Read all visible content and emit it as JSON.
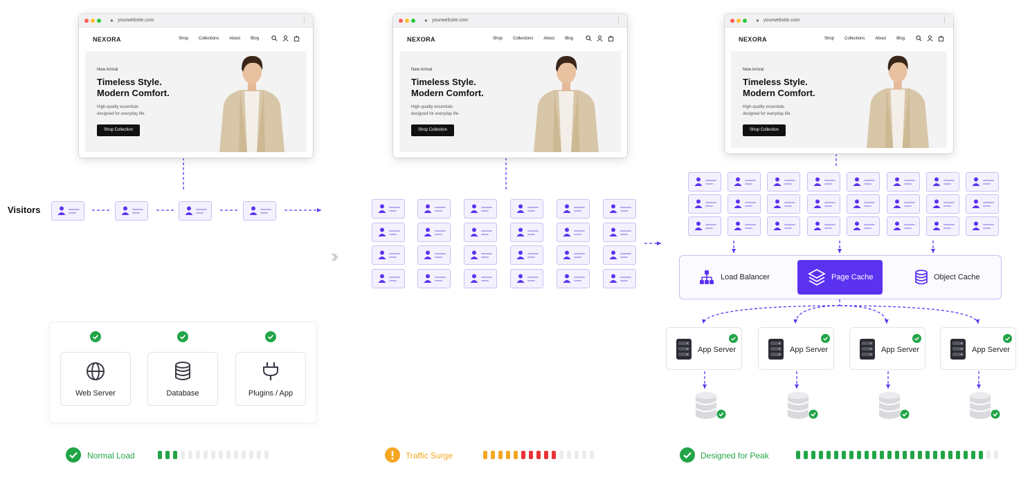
{
  "browser": {
    "url": "yourwebsite.com",
    "brand": "NEXORA",
    "nav": [
      "Shop",
      "Collections",
      "About",
      "Blog"
    ],
    "eyebrow": "New Arrival",
    "headline_1": "Timeless Style.",
    "headline_2": "Modern Comfort.",
    "sub_1": "High-quality essentials",
    "sub_2": "designed for everyday life.",
    "cta": "Shop Collection"
  },
  "visitors_label": "Visitors",
  "stack": {
    "items": [
      {
        "label": "Web Server",
        "icon": "globe-icon"
      },
      {
        "label": "Database",
        "icon": "database-icon"
      },
      {
        "label": "Plugins / App",
        "icon": "plug-icon"
      }
    ]
  },
  "system": {
    "load_balancer": "Load Balancer",
    "page_cache": "Page Cache",
    "object_cache": "Object Cache",
    "app_server": "App Server"
  },
  "status": [
    {
      "label": "Normal Load",
      "color": "#22a447",
      "icon": "check-circle-icon",
      "level": 3,
      "total": 15
    },
    {
      "label": "Traffic Surge",
      "color": "#f5a623",
      "icon": "warning-circle-icon",
      "level": 10,
      "total": 15
    },
    {
      "label": "Designed for Peak",
      "color": "#22a447",
      "icon": "check-circle-icon",
      "level": 25,
      "total": 27
    }
  ],
  "colors": {
    "accent": "#5b32f0",
    "accent_light": "#c9bff5",
    "ok": "#22a447",
    "warn": "#f5a623",
    "danger": "#e8333a",
    "meter_empty": "#ececef"
  }
}
